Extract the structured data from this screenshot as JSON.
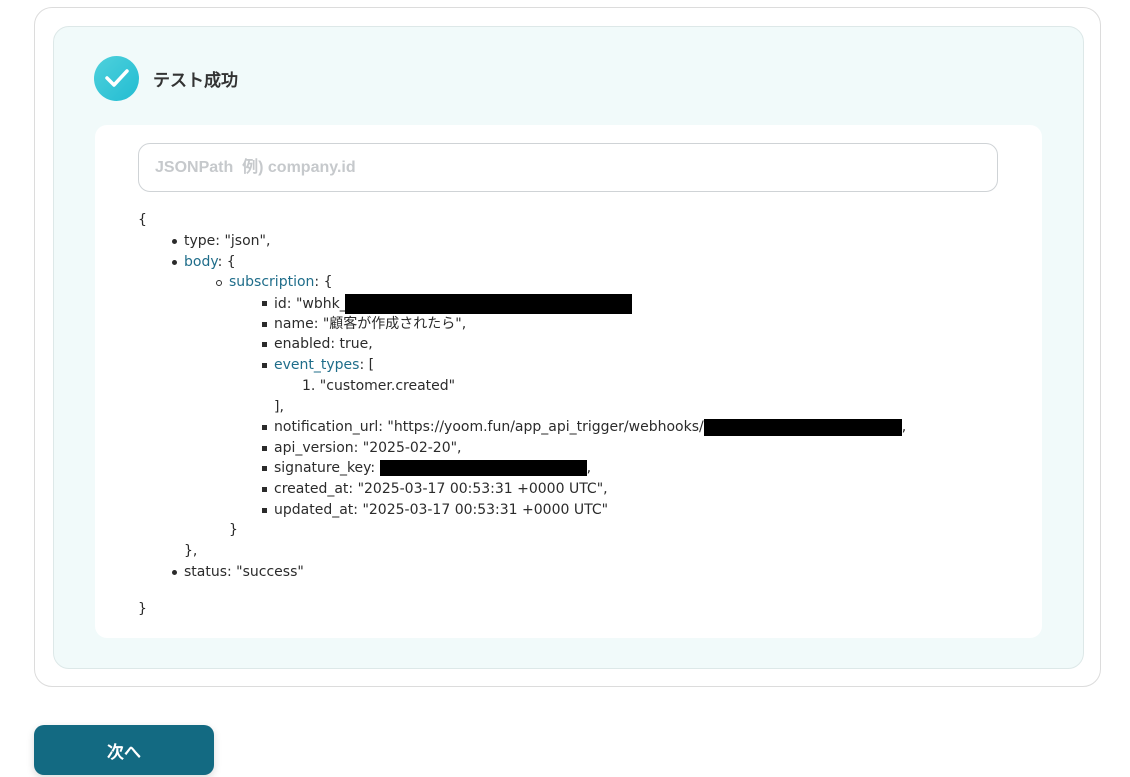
{
  "result": {
    "title": "テスト成功",
    "search": {
      "placeholder": "JSONPath  例) company.id"
    },
    "json": {
      "open": "{",
      "close": "}",
      "type_line": "type: \"json\",",
      "body_key": "body",
      "body_open": ": {",
      "body_close": "},",
      "subscription_key": "subscription",
      "subscription_open": ": {",
      "subscription_close": "}",
      "id_prefix": "id: \"wbhk_",
      "name_line": "name: \"顧客が作成されたら\",",
      "enabled_line": "enabled: true,",
      "event_types_key": "event_types",
      "event_types_open": ": [",
      "event_type_1": "1. \"customer.created\"",
      "event_types_close": "],",
      "notification_url_prefix": "notification_url: \"https://yoom.fun/app_api_trigger/webhooks/",
      "notification_url_suffix": ",",
      "api_version_line": "api_version: \"2025-02-20\",",
      "signature_key_prefix": "signature_key: ",
      "signature_key_suffix": ",",
      "created_at_line": "created_at: \"2025-03-17 00:53:31 +0000 UTC\",",
      "updated_at_line": "updated_at: \"2025-03-17 00:53:31 +0000 UTC\"",
      "status_line": "status: \"success\""
    }
  },
  "footer": {
    "next_label": "次へ"
  },
  "colors": {
    "accent": "#136a82",
    "check": "#22bcd2",
    "key_link": "#1f6d8a",
    "panel_bg": "#f1fafa"
  }
}
